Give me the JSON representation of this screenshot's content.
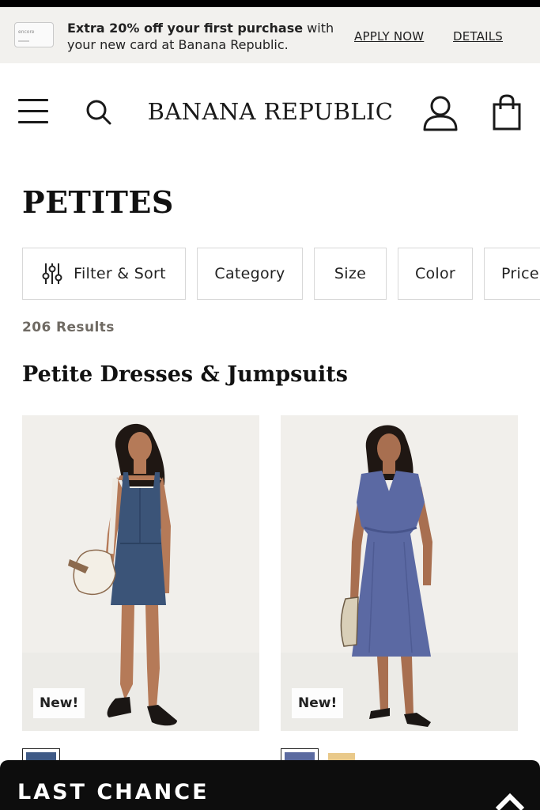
{
  "promo": {
    "card_brand": "encore",
    "text_bold": "Extra 20% off your first purchase",
    "text_rest": " with your new card at Banana Republic.",
    "apply_label": "APPLY NOW",
    "details_label": "DETAILS"
  },
  "header": {
    "logo": "BANANA REPUBLIC",
    "icons": [
      "menu-icon",
      "search-icon",
      "account-icon",
      "shopping-bag-icon"
    ]
  },
  "page": {
    "title": "PETITES",
    "results_count": "206 Results",
    "section_title": "Petite Dresses & Jumpsuits"
  },
  "filters": [
    {
      "label": "Filter & Sort",
      "icon": "sliders-icon"
    },
    {
      "label": "Category"
    },
    {
      "label": "Size"
    },
    {
      "label": "Color"
    },
    {
      "label": "Price"
    }
  ],
  "products": [
    {
      "badge": "New!",
      "swatches": [
        "#3f5a86"
      ]
    },
    {
      "badge": "New!",
      "swatches": [
        "#5b6aa0",
        "#e9c98a"
      ]
    }
  ],
  "bottom_bar": {
    "label": "LAST CHANCE",
    "icon": "chevron-up-icon"
  },
  "colors": {
    "promo_bg": "#f2f1ee",
    "results_text": "#6f6a63",
    "bottom_bar_bg": "#0d0d0d",
    "denim": "#3b5478",
    "dress_blue": "#5b69a3"
  }
}
